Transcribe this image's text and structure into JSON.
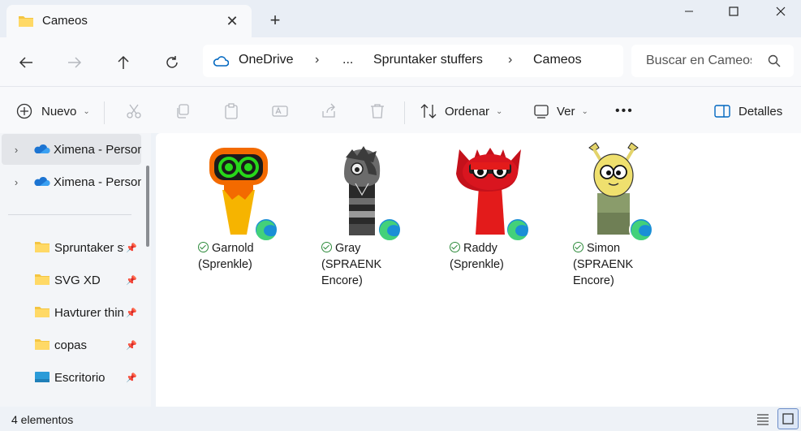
{
  "window": {
    "tab_title": "Cameos",
    "new_tab": "+",
    "close_tab": "✕"
  },
  "address": {
    "crumbs": [
      "OneDrive",
      "...",
      "Spruntaker stuffers",
      "Cameos"
    ]
  },
  "search": {
    "placeholder": "Buscar en Cameos"
  },
  "toolbar": {
    "new_label": "Nuevo",
    "sort_label": "Ordenar",
    "view_label": "Ver",
    "more_label": "•••",
    "details_label": "Detalles"
  },
  "sidebar": {
    "items": [
      {
        "label": "Ximena - Personal",
        "icon": "onedrive-icon"
      },
      {
        "label": "Ximena - Personal",
        "icon": "onedrive-icon"
      },
      {
        "label": "Spruntaker stuffers",
        "icon": "folder-icon"
      },
      {
        "label": "SVG XD",
        "icon": "folder-icon"
      },
      {
        "label": "Havturer things",
        "icon": "folder-icon"
      },
      {
        "label": "copas",
        "icon": "folder-icon"
      },
      {
        "label": "Escritorio",
        "icon": "desktop-icon"
      }
    ]
  },
  "files": [
    {
      "line1": "Garnold",
      "line2": "(Sprenkle)",
      "line3": ""
    },
    {
      "line1": "Gray",
      "line2": "(SPRAENK",
      "line3": "Encore)"
    },
    {
      "line1": "Raddy",
      "line2": "(Sprenkle)",
      "line3": ""
    },
    {
      "line1": "Simon",
      "line2": "(SPRAENK",
      "line3": "Encore)"
    }
  ],
  "status": {
    "count": "4 elementos"
  },
  "colors": {
    "accent": "#0067c0",
    "sync_check": "#2e8b3c",
    "folder": "#f4c542"
  }
}
